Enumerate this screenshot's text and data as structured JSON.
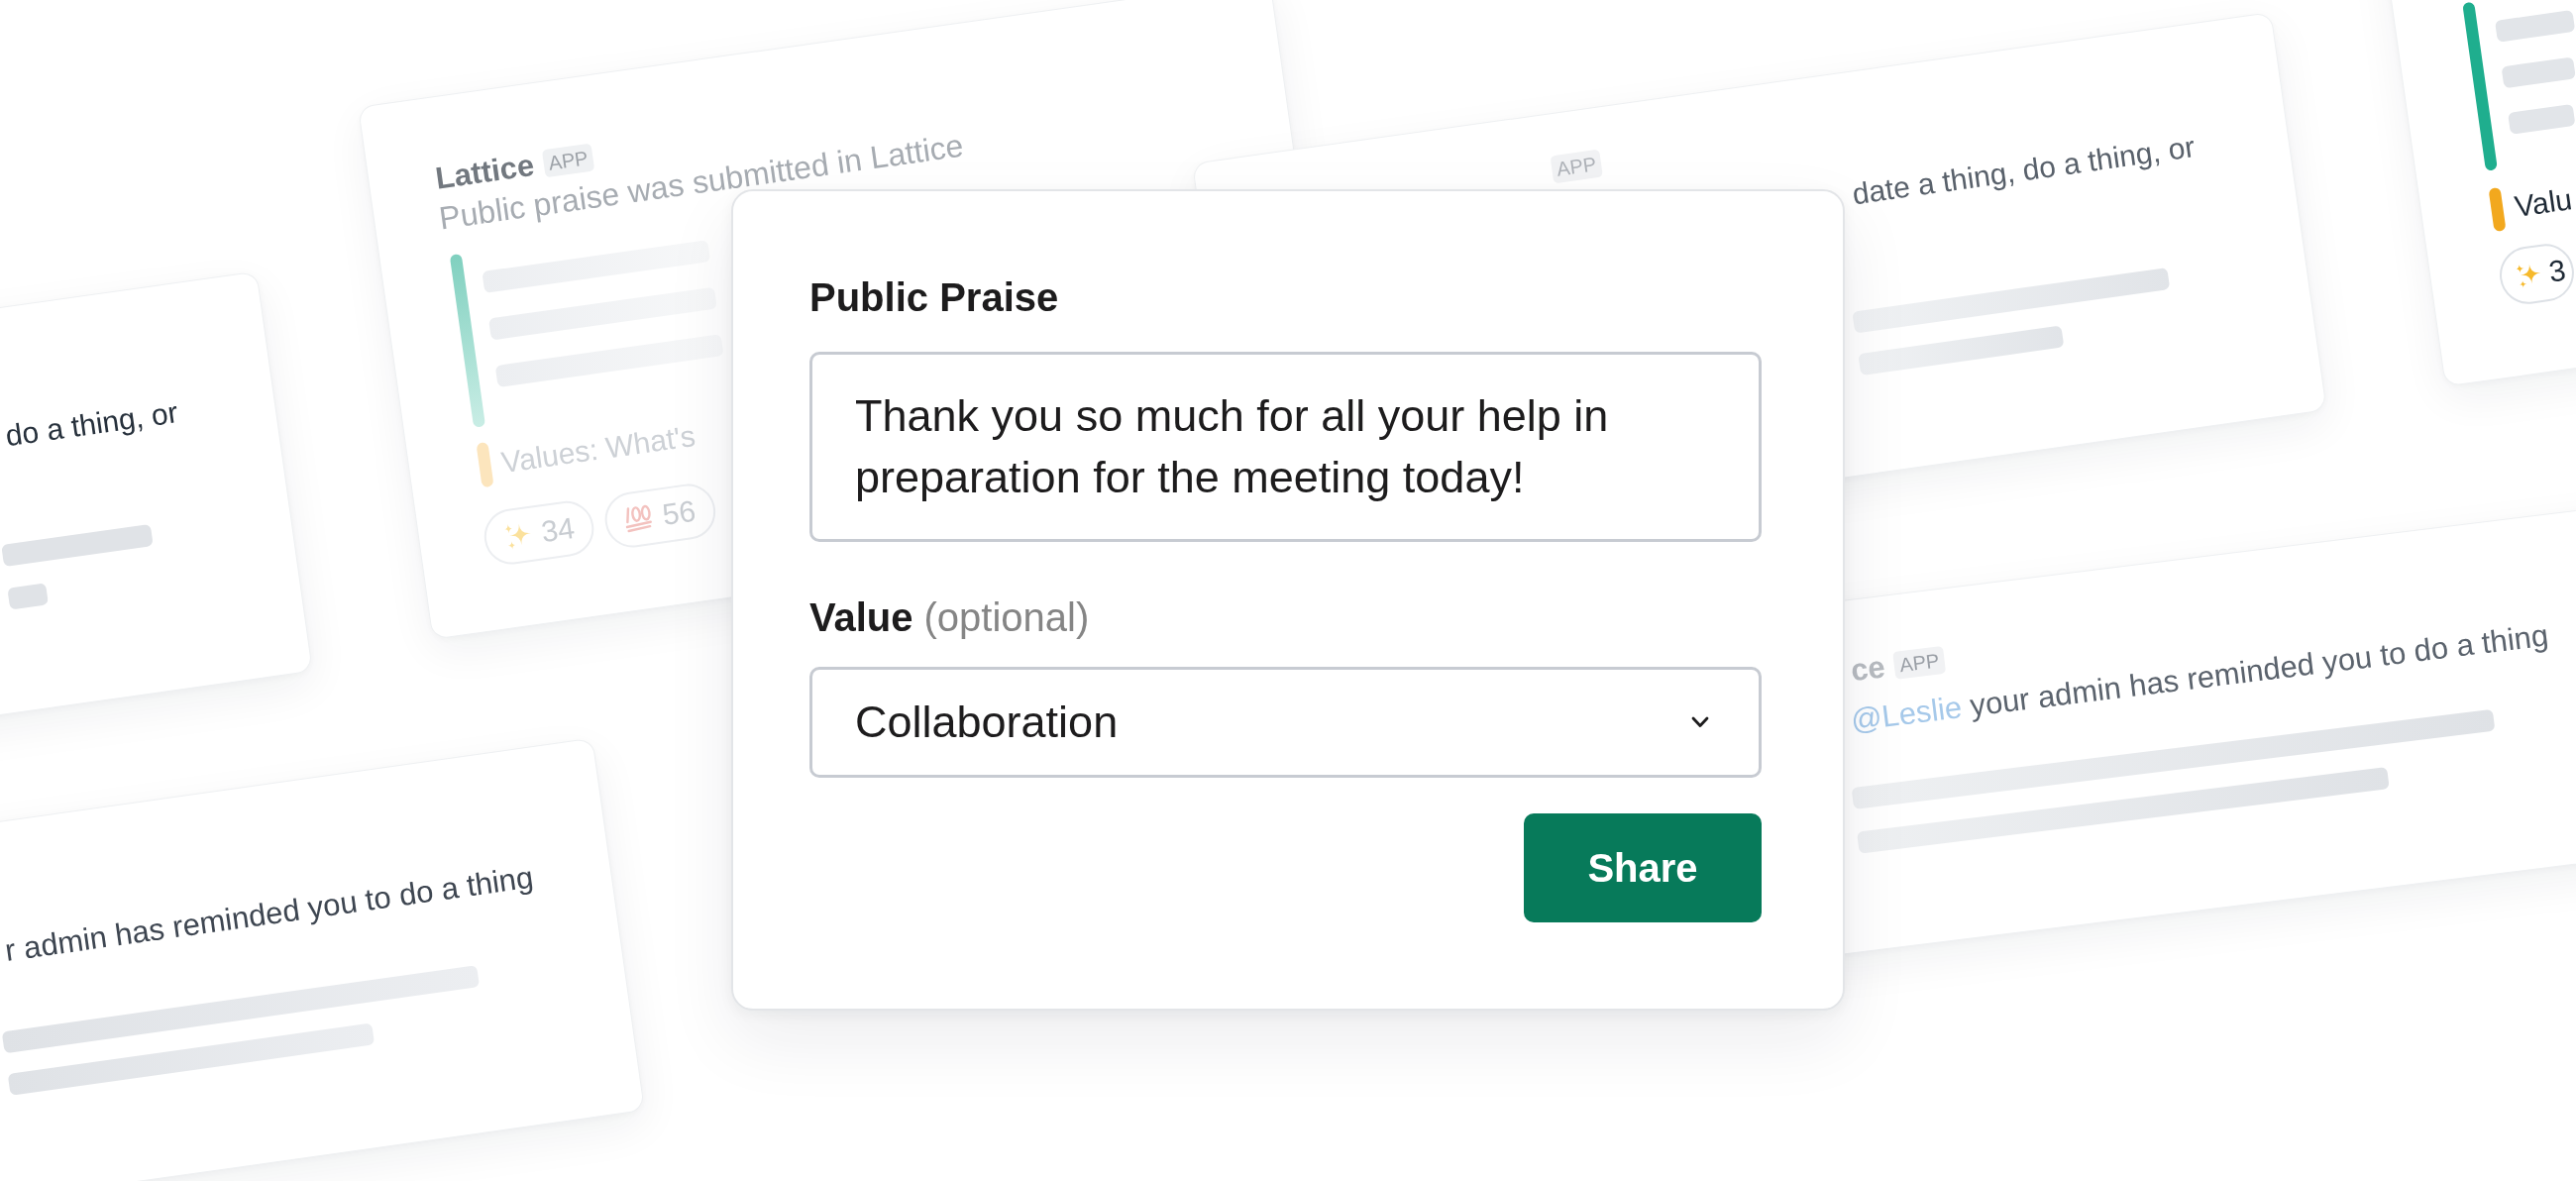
{
  "praise_form": {
    "title": "Public Praise",
    "message_field": {
      "value": "Thank you so much for all your help in preparation for the meeting today!"
    },
    "value_field": {
      "label": "Value",
      "note": "(optional)",
      "value": "Collaboration"
    },
    "submit": {
      "label": "Share"
    }
  },
  "background_cards": [
    {
      "blocks": [
        {
          "kind": "message",
          "text": "do a thing, or"
        },
        {
          "kind": "bar"
        },
        {
          "kind": "bar"
        }
      ]
    },
    {
      "blocks": [
        {
          "kind": "header",
          "name": "Lattice",
          "badge": "APP"
        },
        {
          "kind": "message",
          "text": "Public praise was submitted in Lattice"
        },
        {
          "kind": "quote",
          "children": [
            {
              "kind": "bar"
            },
            {
              "kind": "bar"
            },
            {
              "kind": "bar"
            }
          ]
        },
        {
          "kind": "values",
          "text": "Values: What's"
        },
        {
          "kind": "reactions",
          "items": [
            {
              "kind": "sparkles",
              "count": "34"
            },
            {
              "kind": "hundred",
              "count": "56"
            }
          ]
        }
      ]
    },
    {
      "blocks": [
        {
          "kind": "header",
          "badge": "APP"
        },
        {
          "kind": "message",
          "text": "date a thing, do a thing, or"
        },
        {
          "kind": "bar"
        },
        {
          "kind": "bar"
        }
      ]
    },
    {
      "blocks": [
        {
          "kind": "quote",
          "children": [
            {
              "kind": "bar"
            },
            {
              "kind": "bar"
            },
            {
              "kind": "bar"
            }
          ]
        },
        {
          "kind": "values",
          "text": "Valu"
        },
        {
          "kind": "reactions",
          "items": [
            {
              "kind": "sparkles",
              "count": "3"
            }
          ]
        }
      ]
    },
    {
      "blocks": [
        {
          "kind": "header",
          "name": "ce",
          "badge": "APP"
        },
        {
          "kind": "message",
          "mention": "@Leslie",
          "text": "your admin has reminded you to do a thing"
        },
        {
          "kind": "bar"
        },
        {
          "kind": "bar"
        }
      ]
    },
    {
      "blocks": [
        {
          "kind": "message",
          "text": "r admin has reminded you to do a thing"
        },
        {
          "kind": "bar"
        },
        {
          "kind": "bar"
        }
      ]
    }
  ]
}
